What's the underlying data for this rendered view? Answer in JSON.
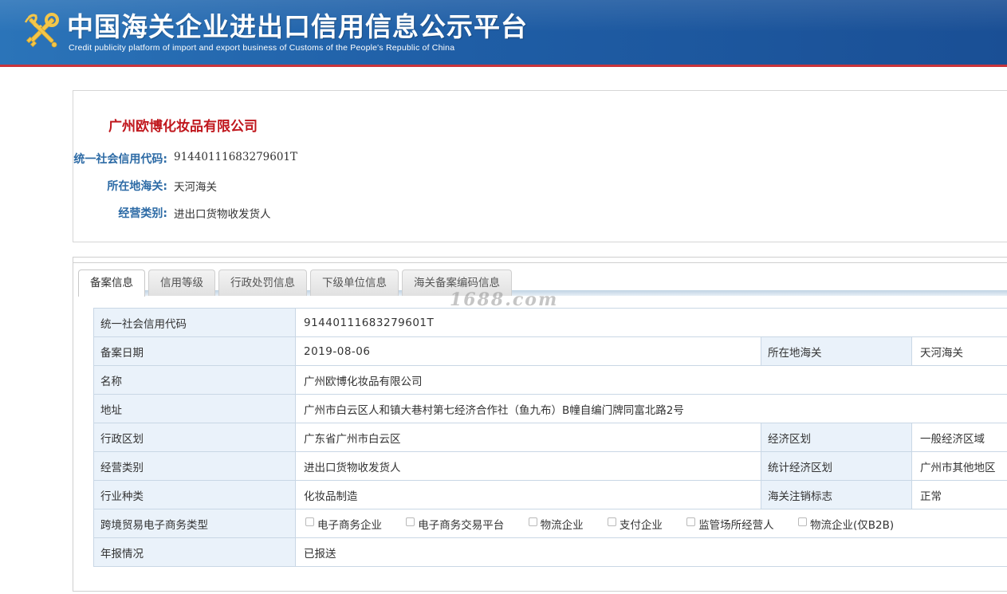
{
  "header": {
    "title": "中国海关企业进出口信用信息公示平台",
    "subtitle": "Credit publicity platform of import and export business of Customs of the People's Republic of China",
    "emblem_icon": "customs-emblem-icon"
  },
  "summary": {
    "company_name": "广州欧博化妆品有限公司",
    "rows": [
      {
        "label": "统一社会信用代码:",
        "value": "91440111683279601T"
      },
      {
        "label": "所在地海关:",
        "value": "天河海关"
      },
      {
        "label": "经营类别:",
        "value": "进出口货物收发货人"
      }
    ]
  },
  "tabs": [
    {
      "label": "备案信息",
      "active": true
    },
    {
      "label": "信用等级",
      "active": false
    },
    {
      "label": "行政处罚信息",
      "active": false
    },
    {
      "label": "下级单位信息",
      "active": false
    },
    {
      "label": "海关备案编码信息",
      "active": false
    }
  ],
  "watermark": "1688.com",
  "record": {
    "credit_code": {
      "label": "统一社会信用代码",
      "value": "91440111683279601T"
    },
    "record_date": {
      "label": "备案日期",
      "value": "2019-08-06"
    },
    "customs": {
      "label": "所在地海关",
      "value": "天河海关"
    },
    "name": {
      "label": "名称",
      "value": "广州欧博化妆品有限公司"
    },
    "address": {
      "label": "地址",
      "value": "广州市白云区人和镇大巷村第七经济合作社（鱼九布）B幢自编门牌同富北路2号"
    },
    "admin_region": {
      "label": "行政区划",
      "value": "广东省广州市白云区"
    },
    "econ_region": {
      "label": "经济区划",
      "value": "一般经济区域"
    },
    "business_type": {
      "label": "经营类别",
      "value": "进出口货物收发货人"
    },
    "stat_region": {
      "label": "统计经济区划",
      "value": "广州市其他地区"
    },
    "industry": {
      "label": "行业种类",
      "value": "化妆品制造"
    },
    "cancel_flag": {
      "label": "海关注销标志",
      "value": "正常"
    },
    "ecommerce": {
      "label": "跨境贸易电子商务类型",
      "options": [
        {
          "label": "电子商务企业",
          "checked": false
        },
        {
          "label": "电子商务交易平台",
          "checked": false
        },
        {
          "label": "物流企业",
          "checked": false
        },
        {
          "label": "支付企业",
          "checked": false
        },
        {
          "label": "监管场所经营人",
          "checked": false
        },
        {
          "label": "物流企业(仅B2B)",
          "checked": false
        }
      ]
    },
    "annual_report": {
      "label": "年报情况",
      "value": "已报送"
    }
  },
  "colors": {
    "banner_blue": "#1f5ea6",
    "banner_red_line": "#c9343b",
    "company_red": "#c0171d",
    "label_blue": "#2c6aa5",
    "table_label_bg": "#eaf2fa",
    "table_border": "#c9d7e5"
  }
}
